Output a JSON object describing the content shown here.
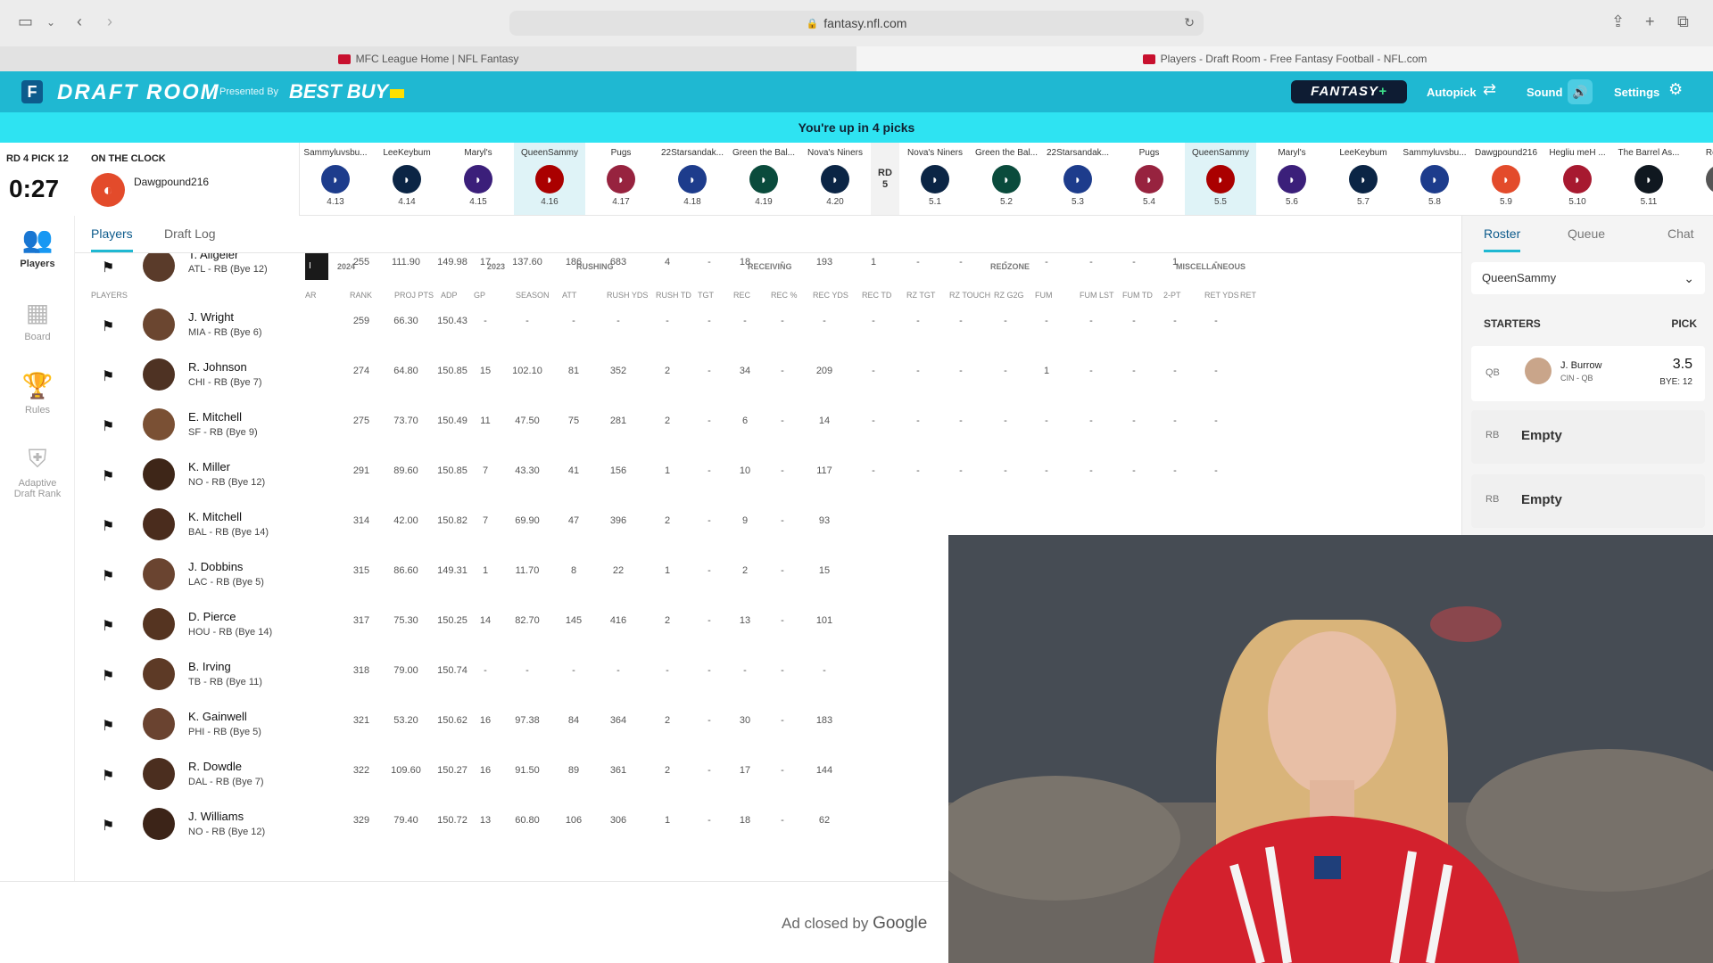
{
  "browser": {
    "url": "fantasy.nfl.com",
    "tabs": [
      {
        "label": "MFC League Home | NFL Fantasy"
      },
      {
        "label": "Players - Draft Room - Free Fantasy Football - NFL.com"
      }
    ]
  },
  "header": {
    "title": "DRAFT ROOM",
    "presented_by": "Presented By",
    "sponsor": "BEST BUY",
    "fantasy_plus": "FANTASY",
    "fantasy_plus_suffix": "+",
    "autopick": "Autopick",
    "sound": "Sound",
    "settings": "Settings",
    "accent": "#1fb8d2"
  },
  "banner": "You're up in 4 picks",
  "clock": {
    "round_pick": "RD 4 PICK 12",
    "on_clock_label": "ON THE CLOCK",
    "timer": "0:27",
    "team": "Dawgpound216"
  },
  "picks": [
    {
      "name": "Sammyluvsbu...",
      "num": "4.13",
      "color": "#1d3c8c"
    },
    {
      "name": "LeeKeybum",
      "num": "4.14",
      "color": "#0b2545"
    },
    {
      "name": "Maryl's",
      "num": "4.15",
      "color": "#3b1f7a"
    },
    {
      "name": "QueenSammy",
      "num": "4.16",
      "color": "#aa0000",
      "highlight": true
    },
    {
      "name": "Pugs",
      "num": "4.17",
      "color": "#97233f"
    },
    {
      "name": "22Starsandak...",
      "num": "4.18",
      "color": "#1d3c8c"
    },
    {
      "name": "Green the Bal...",
      "num": "4.19",
      "color": "#0a4b3c"
    },
    {
      "name": "Nova's Niners",
      "num": "4.20",
      "color": "#0b2545"
    },
    {
      "name": "RD",
      "num": "5",
      "round": true
    },
    {
      "name": "Nova's Niners",
      "num": "5.1",
      "color": "#0b2545"
    },
    {
      "name": "Green the Bal...",
      "num": "5.2",
      "color": "#0a4b3c"
    },
    {
      "name": "22Starsandak...",
      "num": "5.3",
      "color": "#1d3c8c"
    },
    {
      "name": "Pugs",
      "num": "5.4",
      "color": "#97233f"
    },
    {
      "name": "QueenSammy",
      "num": "5.5",
      "color": "#aa0000",
      "highlight": true
    },
    {
      "name": "Maryl's",
      "num": "5.6",
      "color": "#3b1f7a"
    },
    {
      "name": "LeeKeybum",
      "num": "5.7",
      "color": "#0b2545"
    },
    {
      "name": "Sammyluvsbu...",
      "num": "5.8",
      "color": "#1d3c8c"
    },
    {
      "name": "Dawgpound216",
      "num": "5.9",
      "color": "#e34b2b"
    },
    {
      "name": "Hegliu meH ...",
      "num": "5.10",
      "color": "#a71930"
    },
    {
      "name": "The Barrel As...",
      "num": "5.11",
      "color": "#101820"
    },
    {
      "name": "Robo...",
      "num": "",
      "color": "#555"
    }
  ],
  "nav": [
    {
      "label": "Players",
      "icon": "players-icon",
      "glyph": "👥",
      "active": true
    },
    {
      "label": "Board",
      "icon": "board-icon",
      "glyph": "▦"
    },
    {
      "label": "Rules",
      "icon": "trophy-icon",
      "glyph": "🏆"
    },
    {
      "label": "Adaptive Draft Rank",
      "icon": "shield-icon",
      "glyph": "⛨"
    }
  ],
  "subtabs": [
    "Players",
    "Draft Log"
  ],
  "table": {
    "groups": {
      "y2024": "2024",
      "y2023": "2023",
      "rushing": "RUSHING",
      "receiving": "RECEIVING",
      "redzone": "REDZONE",
      "misc": "MISCELLANEOUS"
    },
    "players_header": "PLAYERS",
    "stub_label": "I",
    "columns": [
      "AR",
      "RANK",
      "PROJ PTS",
      "ADP",
      "GP",
      "SEASON",
      "ATT",
      "RUSH YDS",
      "RUSH TD",
      "TGT",
      "REC",
      "REC %",
      "REC YDS",
      "REC TD",
      "RZ TGT",
      "RZ TOUCH",
      "RZ G2G",
      "FUM",
      "FUM LST",
      "FUM TD",
      "2-PT",
      "RET YDS",
      "RET"
    ],
    "rows": [
      {
        "name": "T. Allgeier",
        "team": "ATL - RB (Bye 12)",
        "skin": "#5a3b2a",
        "vals": [
          "",
          "255",
          "111.90",
          "149.98",
          "17",
          "137.60",
          "186",
          "683",
          "4",
          "-",
          "18",
          "-",
          "193",
          "1",
          "-",
          "-",
          "-",
          "-",
          "-",
          "-",
          "1",
          "-"
        ]
      },
      {
        "name": "J. Wright",
        "team": "MIA - RB (Bye 6)",
        "skin": "#6b4630",
        "vals": [
          "",
          "259",
          "66.30",
          "150.43",
          "-",
          "-",
          "-",
          "-",
          "-",
          "-",
          "-",
          "-",
          "-",
          "-",
          "-",
          "-",
          "-",
          "-",
          "-",
          "-",
          "-",
          "-"
        ]
      },
      {
        "name": "R. Johnson",
        "team": "CHI - RB (Bye 7)",
        "skin": "#4e3223",
        "vals": [
          "",
          "274",
          "64.80",
          "150.85",
          "15",
          "102.10",
          "81",
          "352",
          "2",
          "-",
          "34",
          "-",
          "209",
          "-",
          "-",
          "-",
          "-",
          "1",
          "-",
          "-",
          "-",
          "-"
        ]
      },
      {
        "name": "E. Mitchell",
        "team": "SF - RB (Bye 9)",
        "skin": "#7a5034",
        "vals": [
          "",
          "275",
          "73.70",
          "150.49",
          "11",
          "47.50",
          "75",
          "281",
          "2",
          "-",
          "6",
          "-",
          "14",
          "-",
          "-",
          "-",
          "-",
          "-",
          "-",
          "-",
          "-",
          "-"
        ]
      },
      {
        "name": "K. Miller",
        "team": "NO - RB (Bye 12)",
        "skin": "#3e2618",
        "vals": [
          "",
          "291",
          "89.60",
          "150.85",
          "7",
          "43.30",
          "41",
          "156",
          "1",
          "-",
          "10",
          "-",
          "117",
          "-",
          "-",
          "-",
          "-",
          "-",
          "-",
          "-",
          "-",
          "-"
        ]
      },
      {
        "name": "K. Mitchell",
        "team": "BAL - RB (Bye 14)",
        "skin": "#4a2c1d",
        "vals": [
          "",
          "314",
          "42.00",
          "150.82",
          "7",
          "69.90",
          "47",
          "396",
          "2",
          "-",
          "9",
          "-",
          "93"
        ]
      },
      {
        "name": "J. Dobbins",
        "team": "LAC - RB (Bye 5)",
        "skin": "#6a4430",
        "vals": [
          "",
          "315",
          "86.60",
          "149.31",
          "1",
          "11.70",
          "8",
          "22",
          "1",
          "-",
          "2",
          "-",
          "15"
        ]
      },
      {
        "name": "D. Pierce",
        "team": "HOU - RB (Bye 14)",
        "skin": "#553421",
        "vals": [
          "",
          "317",
          "75.30",
          "150.25",
          "14",
          "82.70",
          "145",
          "416",
          "2",
          "-",
          "13",
          "-",
          "101"
        ]
      },
      {
        "name": "B. Irving",
        "team": "TB - RB (Bye 11)",
        "skin": "#5d3a26",
        "vals": [
          "",
          "318",
          "79.00",
          "150.74",
          "-",
          "-",
          "-",
          "-",
          "-",
          "-",
          "-",
          "-",
          "-"
        ]
      },
      {
        "name": "K. Gainwell",
        "team": "PHI - RB (Bye 5)",
        "skin": "#6a4330",
        "vals": [
          "",
          "321",
          "53.20",
          "150.62",
          "16",
          "97.38",
          "84",
          "364",
          "2",
          "-",
          "30",
          "-",
          "183"
        ]
      },
      {
        "name": "R. Dowdle",
        "team": "DAL - RB (Bye 7)",
        "skin": "#4b2e1f",
        "vals": [
          "",
          "322",
          "109.60",
          "150.27",
          "16",
          "91.50",
          "89",
          "361",
          "2",
          "-",
          "17",
          "-",
          "144"
        ]
      },
      {
        "name": "J. Williams",
        "team": "NO - RB (Bye 12)",
        "skin": "#3c2418",
        "vals": [
          "",
          "329",
          "79.40",
          "150.72",
          "13",
          "60.80",
          "106",
          "306",
          "1",
          "-",
          "18",
          "-",
          "62"
        ]
      }
    ]
  },
  "roster": {
    "tabs": [
      "Roster",
      "Queue",
      "Chat"
    ],
    "team": "QueenSammy",
    "starters_label": "STARTERS",
    "pick_label": "PICK",
    "qb": {
      "pos": "QB",
      "name": "J. Burrow",
      "team": "CIN - QB",
      "pick": "3.5",
      "bye": "BYE: 12"
    },
    "slots": [
      {
        "pos": "RB",
        "value": "Empty"
      },
      {
        "pos": "RB",
        "value": "Empty"
      }
    ]
  },
  "ad": {
    "text": "Ad closed by",
    "brand": "Google"
  }
}
